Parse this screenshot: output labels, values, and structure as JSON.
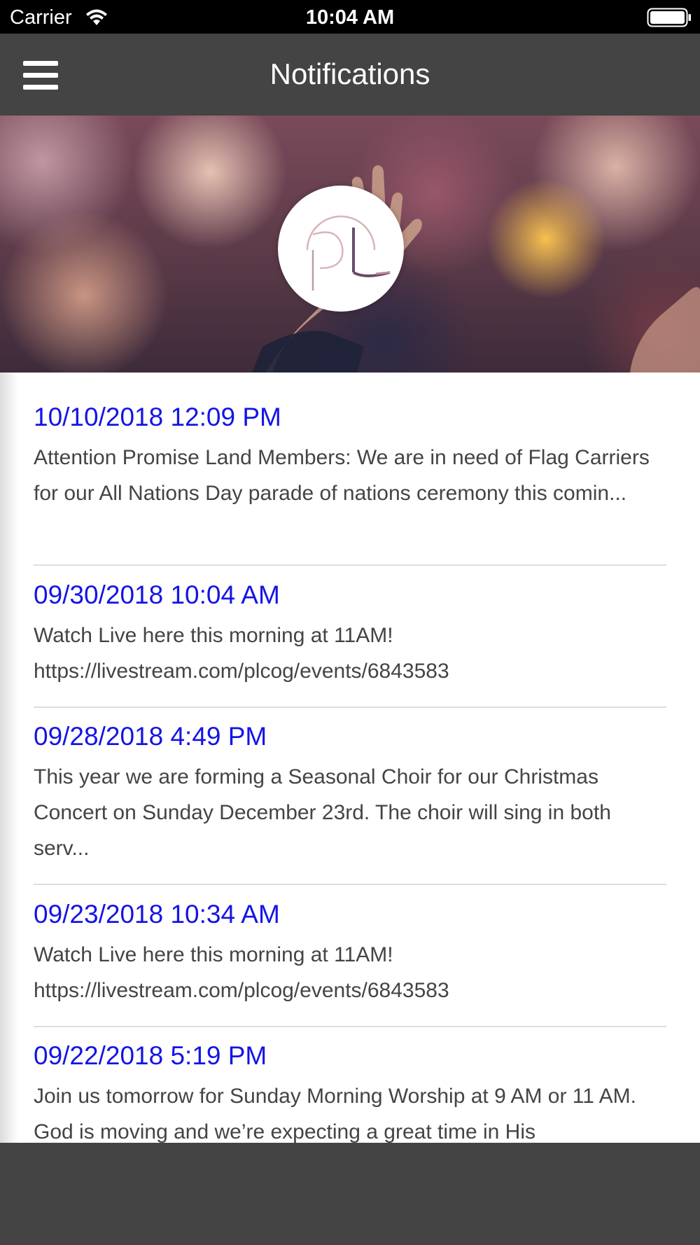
{
  "status_bar": {
    "carrier": "Carrier",
    "time": "10:04 AM",
    "icons": [
      "wifi-icon",
      "battery-icon"
    ]
  },
  "nav": {
    "title": "Notifications",
    "menu_icon": "hamburger-menu-icon"
  },
  "colors": {
    "nav_background": "#444444",
    "date_link": "#1414e6",
    "body_text": "#444444",
    "divider": "#dddddd"
  },
  "notifications": [
    {
      "date": "10/10/2018 12:09 PM",
      "text": "Attention Promise Land Members: We are in need of Flag Carriers for our All Nations Day parade of nations ceremony this comin..."
    },
    {
      "date": "09/30/2018 10:04 AM",
      "text": "Watch Live here this morning at 11AM! https://livestream.com/plcog/events/6843583"
    },
    {
      "date": "09/28/2018 4:49 PM",
      "text": "This year we are forming a Seasonal Choir for our Christmas Concert on Sunday December 23rd. The choir will sing in both serv..."
    },
    {
      "date": "09/23/2018 10:34 AM",
      "text": "Watch Live here this morning at 11AM! https://livestream.com/plcog/events/6843583"
    },
    {
      "date": "09/22/2018 5:19 PM",
      "text": "Join us tomorrow for Sunday Morning Worship at 9 AM or 11 AM. God is moving and we’re expecting a great time in His"
    }
  ]
}
